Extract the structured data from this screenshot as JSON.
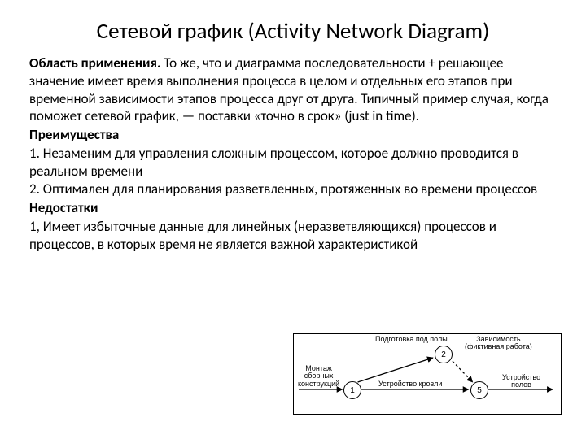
{
  "title": "Сетевой график (Activity Network Diagram)",
  "scope_heading": "Область применения.",
  "scope_text": " То же, что и диаграмма последовательности + решающее значение имеет время выполнения процесса в целом и отдельных его этапов при временной зависимости этапов процесса друг от друга. Типичный пример случая, когда поможет сетевой график, — поставки «точно в срок» (just in time).",
  "adv_heading": "Преимущества",
  "adv1": "1. Незаменим для управления сложным процессом, которое должно проводится в реальном времени",
  "adv2": "2. Оптимален для планирования разветвленных, протяженных во времени процессов",
  "dis_heading": "Недостатки",
  "dis1": "1, Имеет избыточные данные для линейных (неразветвляющихся) процессов и процессов, в которых время не является важной характеристикой",
  "diagram": {
    "n1": "1",
    "n2": "2",
    "n5": "5",
    "lbl_top": "Подготовка под полы",
    "lbl_dep1": "Зависимость",
    "lbl_dep2": "(фиктивная работа)",
    "lbl_left1": "Монтаж",
    "lbl_left2": "сборных",
    "lbl_left3": "конструкций",
    "lbl_mid": "Устройство кровли",
    "lbl_right1": "Устройство",
    "lbl_right2": "полов"
  }
}
